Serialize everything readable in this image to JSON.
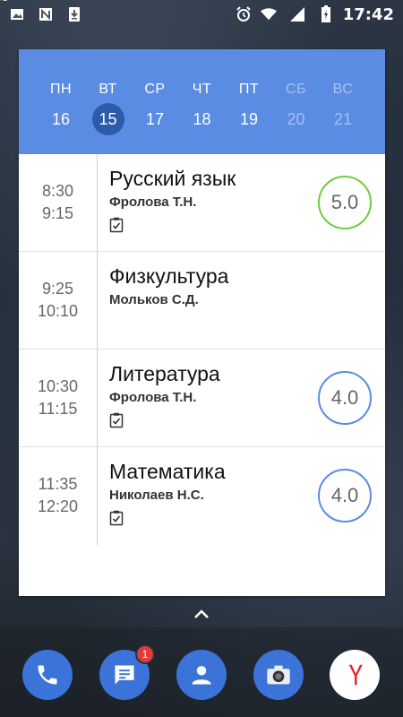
{
  "status_bar": {
    "time": "17:42",
    "network": "3G",
    "icons_left": [
      "image-icon",
      "n-app-icon",
      "download-icon"
    ],
    "icons_right": [
      "alarm-icon",
      "wifi-icon",
      "signal-icon",
      "battery-icon"
    ]
  },
  "week": {
    "days": [
      {
        "name": "ПН",
        "num": "16"
      },
      {
        "name": "ВТ",
        "num": "15"
      },
      {
        "name": "СР",
        "num": "17"
      },
      {
        "name": "ЧТ",
        "num": "18"
      },
      {
        "name": "ПТ",
        "num": "19"
      },
      {
        "name": "СБ",
        "num": "20"
      },
      {
        "name": "ВС",
        "num": "21"
      }
    ],
    "selected_index": 1
  },
  "lessons": [
    {
      "start": "8:30",
      "end": "9:15",
      "subject": "Русский язык",
      "teacher": "Фролова Т.Н.",
      "homework": true,
      "grade": "5.0",
      "grade_color": "#6ccf3c"
    },
    {
      "start": "9:25",
      "end": "10:10",
      "subject": "Физкультура",
      "teacher": "Мольков С.Д.",
      "homework": false,
      "grade": "",
      "grade_color": ""
    },
    {
      "start": "10:30",
      "end": "11:15",
      "subject": "Литература",
      "teacher": "Фролова Т.Н.",
      "homework": true,
      "grade": "4.0",
      "grade_color": "#5b8ce3"
    },
    {
      "start": "11:35",
      "end": "12:20",
      "subject": "Математика",
      "teacher": "Николаев Н.С.",
      "homework": true,
      "grade": "4.0",
      "grade_color": "#5b8ce3"
    }
  ],
  "dock": {
    "apps": [
      "phone-icon",
      "messages-icon",
      "contacts-icon",
      "camera-icon",
      "yandex-icon"
    ],
    "messages_badge": "1"
  },
  "colors": {
    "header_blue": "#5b8ce3",
    "selected_day": "#2e5ba8",
    "grade_green": "#6ccf3c",
    "grade_blue": "#5b8ce3"
  }
}
